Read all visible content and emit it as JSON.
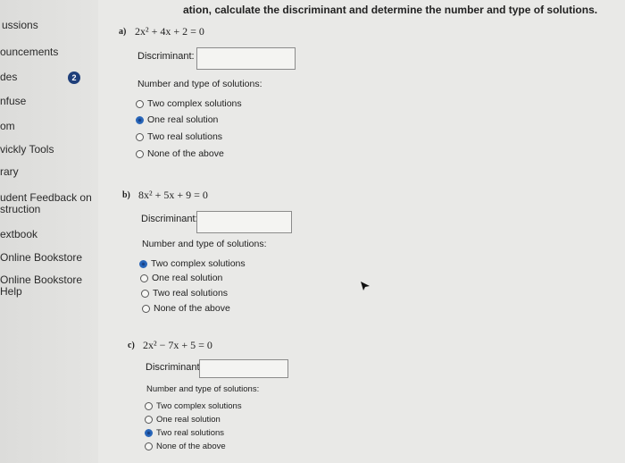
{
  "sidebar": {
    "items": [
      {
        "label": "ussions"
      },
      {
        "label": "ouncements"
      },
      {
        "label": "des",
        "badge": "2"
      },
      {
        "label": "nfuse"
      },
      {
        "label": "om"
      },
      {
        "label": "vickly Tools"
      },
      {
        "label": "rary"
      },
      {
        "label": "udent Feedback on\nstruction"
      },
      {
        "label": "extbook"
      },
      {
        "label": "Online Bookstore"
      },
      {
        "label": "Online Bookstore\nHelp"
      }
    ]
  },
  "header": {
    "title": "ation, calculate the discriminant and determine the number and type of solutions."
  },
  "parts": [
    {
      "label": "a)",
      "equation": "2x² + 4x + 2 = 0",
      "discriminant_label": "Discriminant:",
      "discriminant_value": "",
      "type_label": "Number and type of solutions:",
      "options": [
        "Two complex solutions",
        "One real solution",
        "Two real solutions",
        "None of the above"
      ],
      "selected": 1
    },
    {
      "label": "b)",
      "equation": "8x² + 5x + 9 = 0",
      "discriminant_label": "Discriminant:",
      "discriminant_value": "",
      "type_label": "Number and type of solutions:",
      "options": [
        "Two complex solutions",
        "One real solution",
        "Two real solutions",
        "None of the above"
      ],
      "selected": 0
    },
    {
      "label": "c)",
      "equation": "2x² − 7x + 5 = 0",
      "discriminant_label": "Discriminant:",
      "discriminant_value": "",
      "type_label": "Number and type of solutions:",
      "options": [
        "Two complex solutions",
        "One real solution",
        "Two real solutions",
        "None of the above"
      ],
      "selected": 2
    }
  ],
  "icons": {
    "cursor": "mouse-pointer-icon"
  },
  "colors": {
    "selected_radio": "#1f5fb5",
    "badge": "#1f3f7a"
  }
}
